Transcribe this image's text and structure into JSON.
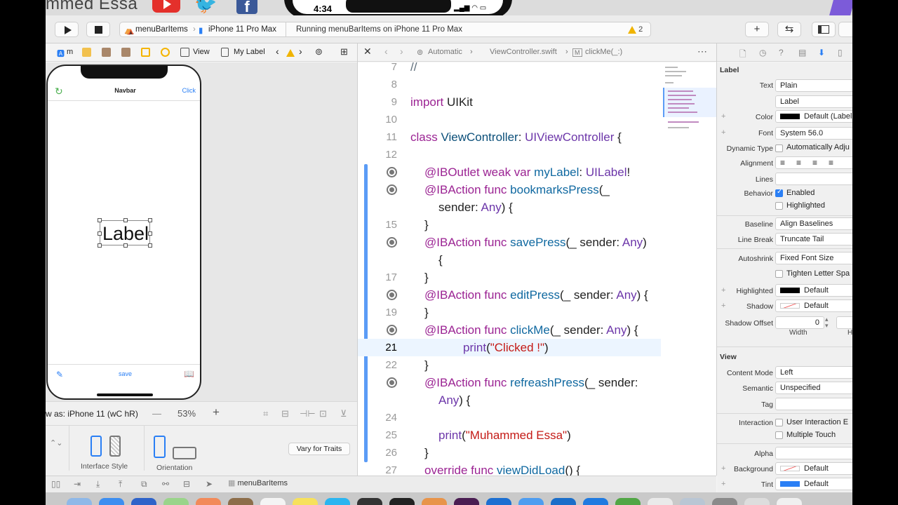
{
  "banner": {
    "owner": "mmed Essa",
    "clock": "4:34"
  },
  "toolbar": {
    "scheme_target": "menuBarItems",
    "scheme_device": "iPhone 11 Pro Max",
    "activity": "Running menuBarItems on iPhone 11 Pro Max",
    "warning_count": "2",
    "plus": "+",
    "swap": "⇆"
  },
  "left_jumpbar": {
    "view": "View",
    "label": "My Label",
    "partial": "m"
  },
  "device": {
    "nav_title": "Navbar",
    "nav_click": "Click",
    "label_text": "Label",
    "tab_save": "save"
  },
  "canvas_bottom": {
    "view_as": "w as: iPhone 11 (wC hR)",
    "zoom": "53%",
    "minus": "—",
    "plus": "+"
  },
  "traits": {
    "interface_style": "Interface Style",
    "orientation": "Orientation",
    "vary": "Vary for Traits"
  },
  "bottom_bar": {
    "filter": "menuBarItems"
  },
  "code_jumpbar": {
    "automatic": "Automatic",
    "file": "ViewController.swift",
    "method": "clickMe(_:)"
  },
  "code": {
    "lines": [
      {
        "n": "7",
        "text": "//"
      },
      {
        "n": "8",
        "text": ""
      },
      {
        "n": "9",
        "kw": "import",
        "rest": " UIKit"
      },
      {
        "n": "10",
        "text": ""
      },
      {
        "n": "11",
        "kw": "class",
        "name": " ViewController",
        "sep": ": ",
        "type": "UIViewController",
        "tail": " {"
      },
      {
        "n": "12",
        "text": ""
      },
      {
        "n": "",
        "bp": true,
        "p1": "@IBOutlet weak var ",
        "p2": "myLabel",
        "p3": ": ",
        "p4": "UILabel",
        "p5": "!"
      },
      {
        "n": "",
        "bp": true,
        "p1": "@IBAction func ",
        "p2": "bookmarksPress",
        "p3": "(_",
        "p4": "",
        "p5": ""
      },
      {
        "n": "",
        "indent2": "sender: ",
        "any": "Any",
        "tail": ") {"
      },
      {
        "n": "15",
        "brace": "}"
      },
      {
        "n": "",
        "bp": true,
        "p1": "@IBAction func ",
        "p2": "savePress",
        "p3": "(_ sender: ",
        "p4": "Any",
        "p5": ")"
      },
      {
        "n": "",
        "indent3": "{"
      },
      {
        "n": "17",
        "brace": "}"
      },
      {
        "n": "",
        "bp": true,
        "p1": "@IBAction func ",
        "p2": "editPress",
        "p3": "(_ sender: ",
        "p4": "Any",
        "p5": ") {"
      },
      {
        "n": "19",
        "brace": "}"
      },
      {
        "n": "",
        "bp": true,
        "p1": "@IBAction func ",
        "p2": "clickMe",
        "p3": "(_ sender: ",
        "p4": "Any",
        "p5": ") {"
      },
      {
        "n": "21",
        "print": "print",
        "str": "\"Clicked !\"",
        "cur": true
      },
      {
        "n": "22",
        "brace": "}"
      },
      {
        "n": "",
        "bp": true,
        "p1": "@IBAction func ",
        "p2": "refreashPress",
        "p3": "(_ sender:",
        "p4": "",
        "p5": ""
      },
      {
        "n": "",
        "indent2": "",
        "any": "Any",
        "tail": ") {"
      },
      {
        "n": "24",
        "text": ""
      },
      {
        "n": "25",
        "print2": "print",
        "str": "\"Muhammed Essa\""
      },
      {
        "n": "26",
        "brace": "}"
      },
      {
        "n": "27",
        "override": "override func ",
        "name": "viewDidLoad",
        "tail": "() {"
      }
    ]
  },
  "inspector": {
    "label_section": "Label",
    "text_label": "Text",
    "text_value": "Plain",
    "label_value": "Label",
    "color_label": "Color",
    "color_value": "Default (Label",
    "font_label": "Font",
    "font_value": "System 56.0",
    "dyn_label": "Dynamic Type",
    "dyn_value": "Automatically Adju",
    "align_label": "Alignment",
    "lines_label": "Lines",
    "behavior_label": "Behavior",
    "enabled": "Enabled",
    "highlighted": "Highlighted",
    "baseline_label": "Baseline",
    "baseline_value": "Align Baselines",
    "linebreak_label": "Line Break",
    "linebreak_value": "Truncate Tail",
    "autoshrink_label": "Autoshrink",
    "autoshrink_value": "Fixed Font Size",
    "tighten": "Tighten Letter Spa",
    "highlighted_label": "Highlighted",
    "highlighted_value": "Default",
    "shadow_label": "Shadow",
    "shadow_value": "Default",
    "shadow_offset_label": "Shadow Offset",
    "shadow_offset_value": "0",
    "width_label": "Width",
    "height_partial": "H",
    "view_section": "View",
    "content_mode_label": "Content Mode",
    "content_mode_value": "Left",
    "semantic_label": "Semantic",
    "semantic_value": "Unspecified",
    "tag_label": "Tag",
    "interaction_label": "Interaction",
    "user_interaction": "User Interaction E",
    "multiple_touch": "Multiple Touch",
    "alpha_label": "Alpha",
    "background_label": "Background",
    "background_value": "Default",
    "tint_label": "Tint",
    "tint_value": "Default"
  },
  "colors": {
    "accent": "#2a7ff5",
    "keyword": "#9b2393",
    "string": "#c41a16",
    "type": "#0b4f79"
  }
}
